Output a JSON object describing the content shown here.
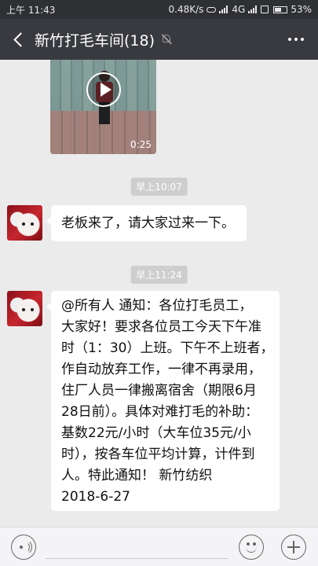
{
  "status_bar": {
    "time": "上午 11:43",
    "net_speed": "0.48K/s",
    "network_type": "4G",
    "battery": "53%",
    "battery_level": 0.53
  },
  "nav": {
    "title": "新竹打毛车间(18)",
    "back_icon": "chevron-left-icon",
    "mute_icon": "bell-muted-icon",
    "more_icon": "more-dots-icon"
  },
  "video_message": {
    "duration": "0:25",
    "play_icon": "play-icon"
  },
  "timestamps": [
    "早上10:07",
    "早上11:24"
  ],
  "messages": [
    {
      "text": "老板来了，请大家过来一下。"
    },
    {
      "lines": [
        "@所有人  通知：各位打毛员工，",
        "大家好！要求各位员工今天下午准",
        "时（1：30）上班。下午不上班者，",
        "作自动放弃工作，一律不再录用，",
        "住厂人员一律搬离宿舍（期限6月",
        "28日前）。具体对难打毛的补助：",
        "基数22元/小时（大车位35元/小",
        "时），按各车位平均计算，计件到",
        "人。特此通知！    新竹纺织",
        "2018-6-27"
      ]
    }
  ],
  "input_bar": {
    "voice_icon": "voice-icon",
    "input_value": "",
    "emoji_icon": "emoji-icon",
    "plus_icon": "plus-icon"
  }
}
